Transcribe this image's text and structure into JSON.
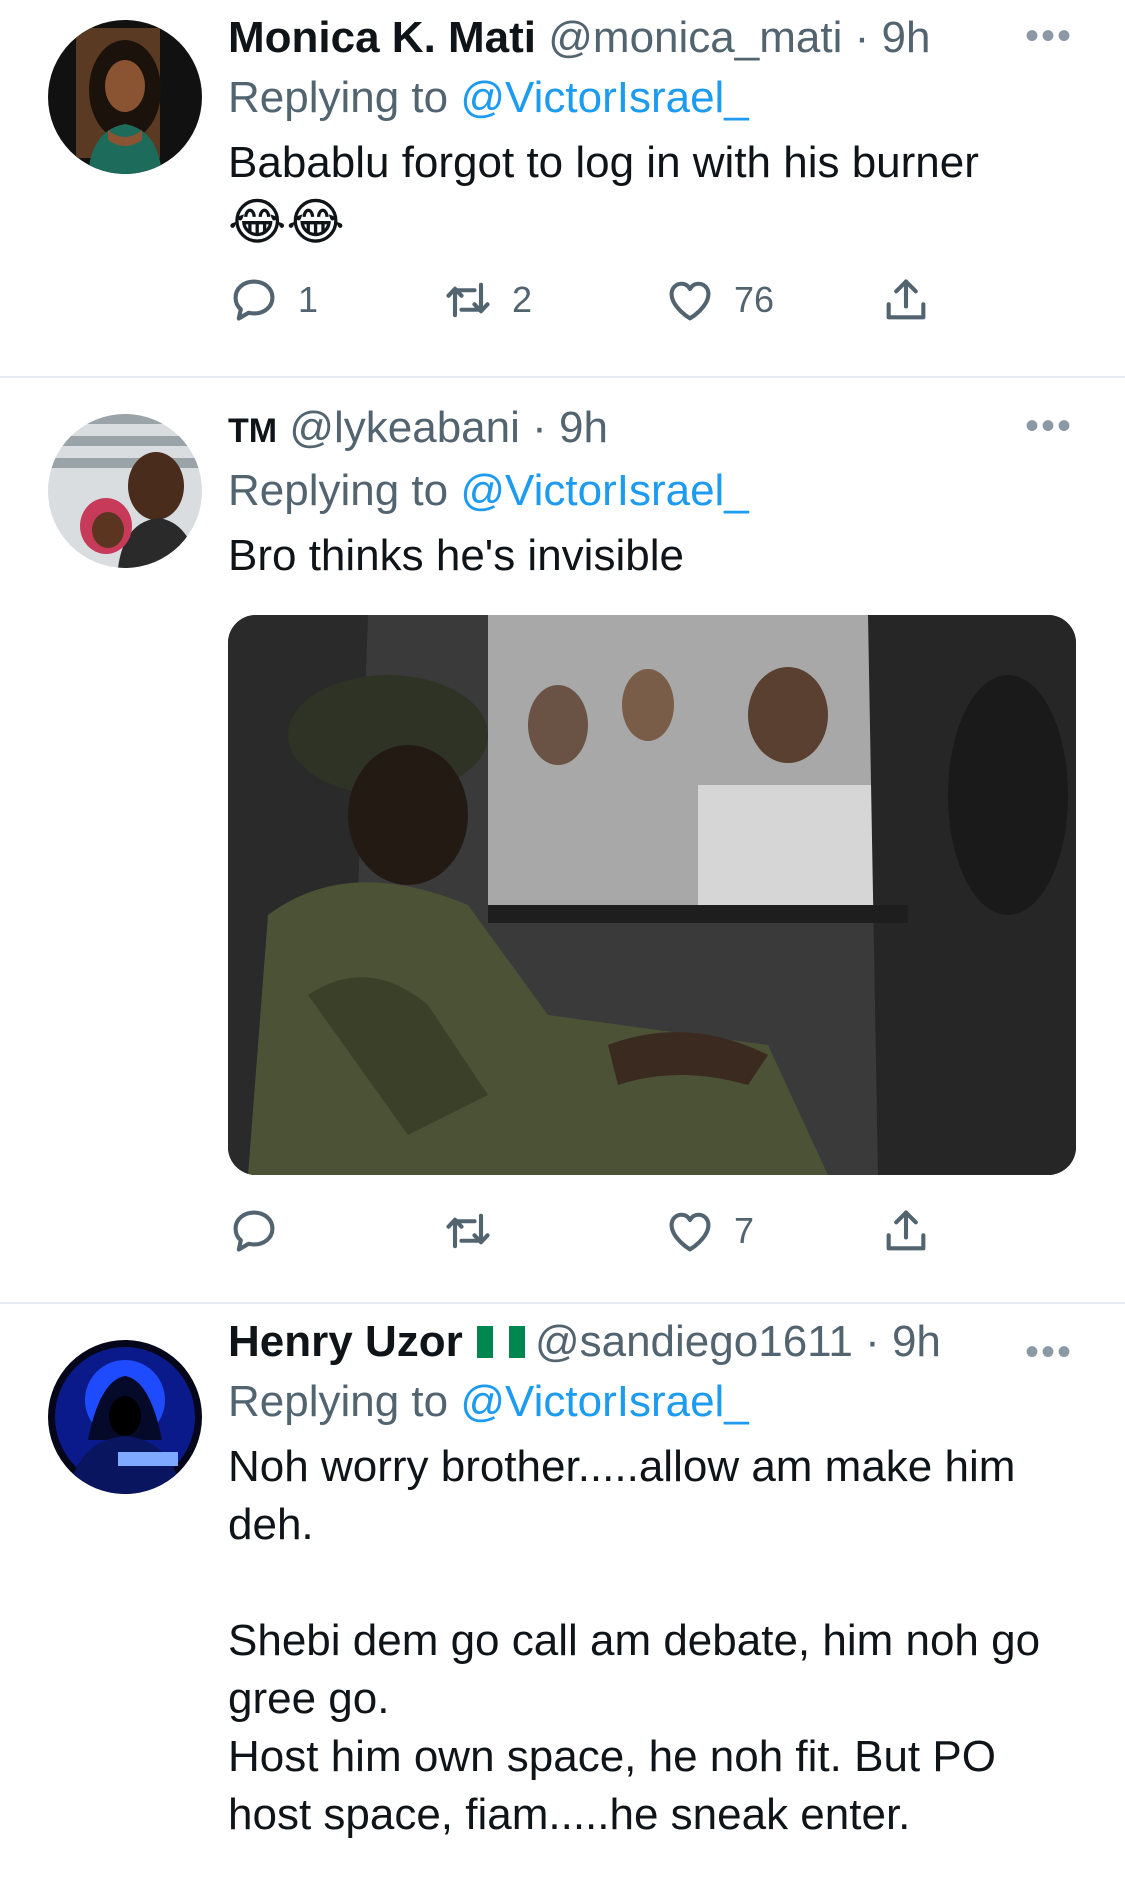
{
  "tweets": [
    {
      "display_name": "Monica K. Mati",
      "handle": "@monica_mati",
      "time": "9h",
      "more_label": "•••",
      "replying_prefix": "Replying to",
      "replying_to": "@VictorIsrael_",
      "text": "Babablu forgot to log in with his burner",
      "emoji": "😂😂",
      "replies": "1",
      "retweets": "2",
      "likes": "76"
    },
    {
      "display_name": "TM",
      "handle": "@lykeabani",
      "time": "9h",
      "more_label": "•••",
      "replying_prefix": "Replying to",
      "replying_to": "@VictorIsrael_",
      "text": "Bro thinks he's invisible",
      "likes": "7"
    },
    {
      "display_name": "Henry Uzor",
      "handle": "@sandiego1611",
      "time": "9h",
      "more_label": "•••",
      "replying_prefix": "Replying to",
      "replying_to": "@VictorIsrael_",
      "text": "Noh worry brother.....allow am make him deh.\n\nShebi dem go call am debate, him noh go gree go.\nHost him own space, he noh fit. But PO host space, fiam.....he sneak enter."
    }
  ],
  "icons": {
    "reply": "reply-icon",
    "retweet": "retweet-icon",
    "like": "heart-icon",
    "share": "share-icon",
    "flag": "nigeria-flag-icon"
  },
  "colors": {
    "link": "#1d9bf0",
    "secondary": "#536471",
    "divider": "#e6ecf0",
    "text": "#0f1419"
  }
}
